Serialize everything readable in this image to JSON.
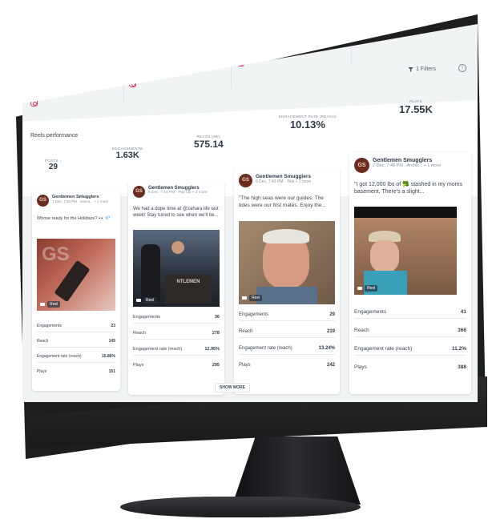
{
  "tabs": [
    {
      "icon": "instagram-icon"
    },
    {
      "icon": "instagram-icon"
    },
    {
      "icon": "instagram-icon"
    },
    {
      "icon": "instagram-icon"
    }
  ],
  "toolbar": {
    "filters_label": "1 Filters",
    "info_glyph": "i"
  },
  "reels_performance": {
    "title": "Reels performance",
    "metrics": [
      {
        "label": "POSTS ↓",
        "value": "29"
      },
      {
        "label": "ENGAGEMENTS",
        "value": "1.63K"
      },
      {
        "label": "REACH (ME)",
        "value": "575.14"
      },
      {
        "label": "ENGAGEMENT RATE (REACH)",
        "value": "10.13%"
      },
      {
        "label": "PLAYS",
        "value": "17.55K"
      }
    ]
  },
  "stat_labels": {
    "engagements": "Engagements",
    "reach": "Reach",
    "engagement_rate": "Engagement rate (reach)",
    "plays": "Plays"
  },
  "cards": [
    {
      "account": "Gentlemen Smugglers",
      "meta": "7 Dec, 7:00 PM · anima... + 1 more",
      "caption": "Whose ready for the Holidaze? 👀 💎",
      "reel_tag": "Reel",
      "stats": {
        "engagements": "23",
        "reach": "145",
        "engagement_rate": "15.86%",
        "plays": "151"
      }
    },
    {
      "account": "Gentlemen Smugglers",
      "meta": "6 Dec, 7:14 PM · Pop Up + 2 more",
      "caption": "We had a dope time at @zahara.life last week! Stay tuned to see when we'll be...",
      "reel_tag": "Reel",
      "stats": {
        "engagements": "36",
        "reach": "278",
        "engagement_rate": "12.95%",
        "plays": "295"
      }
    },
    {
      "account": "Gentlemen Smugglers",
      "meta": "6 Dec, 7:43 PM · Tink + 1 more",
      "caption": "\"The high seas were our guides. The tides were our first mates. Enjoy the...",
      "reel_tag": "Reel",
      "stats": {
        "engagements": "29",
        "reach": "219",
        "engagement_rate": "13.24%",
        "plays": "242"
      }
    },
    {
      "account": "Gentlemen Smugglers",
      "meta": "2 Dec, 7:48 PM · Archiv... + 1 more",
      "caption": "\"I got 12,000 lbs of 🥦 stashed in my moms basement. There's a slight...",
      "reel_tag": "Reel",
      "stats": {
        "engagements": "41",
        "reach": "366",
        "engagement_rate": "11.2%",
        "plays": "388"
      }
    }
  ],
  "show_more_label": "SHOW MORE",
  "avatar_initials": "GS",
  "colors": {
    "instagram": "#e03a6a",
    "avatar": "#6b2b1f",
    "screen_bg": "#f1f4f5"
  }
}
